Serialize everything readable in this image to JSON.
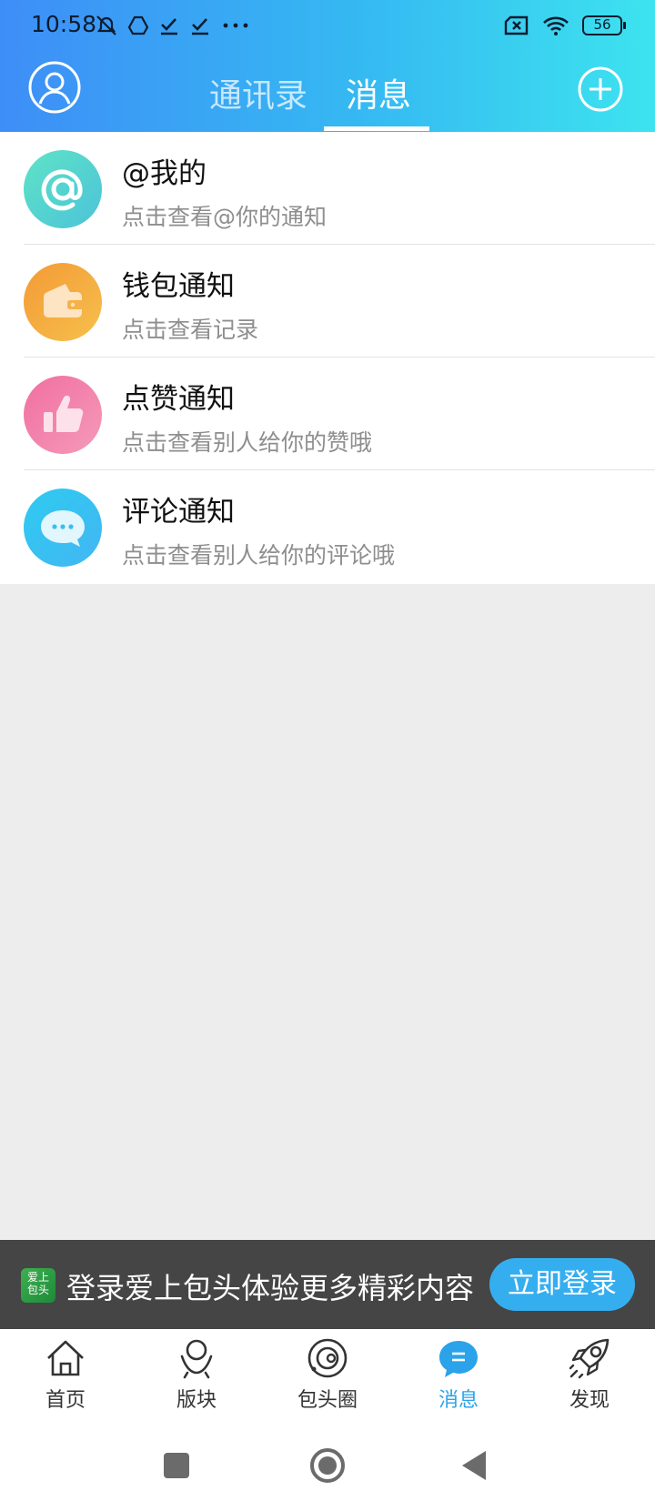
{
  "status_bar": {
    "time": "10:58",
    "battery": "56"
  },
  "header": {
    "tabs": [
      {
        "label": "通讯录",
        "active": false
      },
      {
        "label": "消息",
        "active": true
      }
    ]
  },
  "notifications": [
    {
      "icon": "at-icon",
      "color": "#4fd1c5",
      "title": "@我的",
      "subtitle": "点击查看@你的通知"
    },
    {
      "icon": "wallet-icon",
      "color": "#f4a43a",
      "title": "钱包通知",
      "subtitle": "点击查看记录"
    },
    {
      "icon": "thumbs-up-icon",
      "color": "#f27fa8",
      "title": "点赞通知",
      "subtitle": "点击查看别人给你的赞哦"
    },
    {
      "icon": "comment-icon",
      "color": "#35c2f1",
      "title": "评论通知",
      "subtitle": "点击查看别人给你的评论哦"
    }
  ],
  "login_banner": {
    "logo_text": "爱上包头",
    "text": "登录爱上包头体验更多精彩内容",
    "button": "立即登录"
  },
  "bottom_nav": [
    {
      "icon": "home-icon",
      "label": "首页",
      "active": false
    },
    {
      "icon": "section-icon",
      "label": "版块",
      "active": false
    },
    {
      "icon": "circle-icon",
      "label": "包头圈",
      "active": false
    },
    {
      "icon": "message-icon",
      "label": "消息",
      "active": true
    },
    {
      "icon": "rocket-icon",
      "label": "发现",
      "active": false
    }
  ],
  "colors": {
    "accent": "#35aef0",
    "header_start": "#3e8ef7",
    "header_end": "#3de3ef"
  }
}
